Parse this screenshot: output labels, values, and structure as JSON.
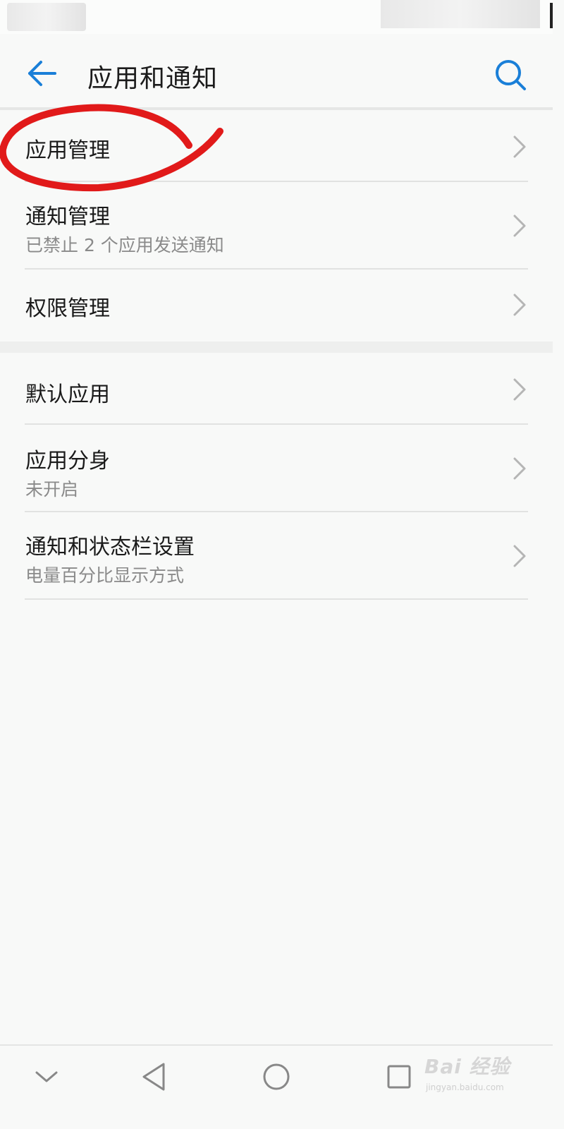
{
  "header": {
    "title": "应用和通知",
    "back_icon": "arrow-left-icon",
    "search_icon": "search-icon"
  },
  "group1": [
    {
      "label": "应用管理",
      "sub": ""
    },
    {
      "label": "通知管理",
      "sub": "已禁止 2 个应用发送通知"
    },
    {
      "label": "权限管理",
      "sub": ""
    }
  ],
  "group2": [
    {
      "label": "默认应用",
      "sub": ""
    },
    {
      "label": "应用分身",
      "sub": "未开启"
    },
    {
      "label": "通知和状态栏设置",
      "sub": "电量百分比显示方式"
    }
  ],
  "nav": {
    "icons": [
      "chevron-down-icon",
      "back-triangle-icon",
      "home-circle-icon",
      "recents-square-icon"
    ]
  },
  "watermark": {
    "brand": "Bai 经验",
    "url": "jingyan.baidu.com"
  },
  "colors": {
    "accent": "#1a7fd8",
    "annotation": "#e11a1a",
    "subtext": "#8a8a8a"
  }
}
